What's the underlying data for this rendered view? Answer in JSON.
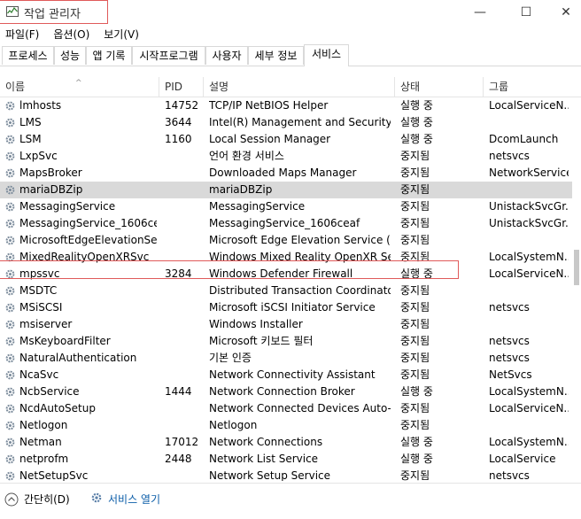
{
  "window": {
    "title": "작업 관리자",
    "minimize": "—",
    "maximize": "☐",
    "close": "✕"
  },
  "menu": [
    {
      "label": "파일(F)"
    },
    {
      "label": "옵션(O)"
    },
    {
      "label": "보기(V)"
    }
  ],
  "tabs": [
    {
      "label": "프로세스",
      "active": false
    },
    {
      "label": "성능",
      "active": false
    },
    {
      "label": "앱 기록",
      "active": false
    },
    {
      "label": "시작프로그램",
      "active": false
    },
    {
      "label": "사용자",
      "active": false
    },
    {
      "label": "세부 정보",
      "active": false
    },
    {
      "label": "서비스",
      "active": true
    }
  ],
  "columns": {
    "name": "이름",
    "pid": "PID",
    "desc": "설명",
    "status": "상태",
    "group": "그룹"
  },
  "rows": [
    {
      "name": "lmhosts",
      "pid": "14752",
      "desc": "TCP/IP NetBIOS Helper",
      "status": "실행 중",
      "group": "LocalServiceN..."
    },
    {
      "name": "LMS",
      "pid": "3644",
      "desc": "Intel(R) Management and Security ...",
      "status": "실행 중",
      "group": ""
    },
    {
      "name": "LSM",
      "pid": "1160",
      "desc": "Local Session Manager",
      "status": "실행 중",
      "group": "DcomLaunch"
    },
    {
      "name": "LxpSvc",
      "pid": "",
      "desc": "언어 환경 서비스",
      "status": "중지됨",
      "group": "netsvcs"
    },
    {
      "name": "MapsBroker",
      "pid": "",
      "desc": "Downloaded Maps Manager",
      "status": "중지됨",
      "group": "NetworkService"
    },
    {
      "name": "mariaDBZip",
      "pid": "",
      "desc": "mariaDBZip",
      "status": "중지됨",
      "group": "",
      "selected": true
    },
    {
      "name": "MessagingService",
      "pid": "",
      "desc": "MessagingService",
      "status": "중지됨",
      "group": "UnistackSvcGr..."
    },
    {
      "name": "MessagingService_1606ceaf",
      "pid": "",
      "desc": "MessagingService_1606ceaf",
      "status": "중지됨",
      "group": "UnistackSvcGr..."
    },
    {
      "name": "MicrosoftEdgeElevationSer...",
      "pid": "",
      "desc": "Microsoft Edge Elevation Service (...",
      "status": "중지됨",
      "group": ""
    },
    {
      "name": "MixedRealityOpenXRSvc",
      "pid": "",
      "desc": "Windows Mixed Reality OpenXR Ser...",
      "status": "중지됨",
      "group": "LocalSystemN..."
    },
    {
      "name": "mpssvc",
      "pid": "3284",
      "desc": "Windows Defender Firewall",
      "status": "실행 중",
      "group": "LocalServiceN..."
    },
    {
      "name": "MSDTC",
      "pid": "",
      "desc": "Distributed Transaction Coordinator",
      "status": "중지됨",
      "group": ""
    },
    {
      "name": "MSiSCSI",
      "pid": "",
      "desc": "Microsoft iSCSI Initiator Service",
      "status": "중지됨",
      "group": "netsvcs"
    },
    {
      "name": "msiserver",
      "pid": "",
      "desc": "Windows Installer",
      "status": "중지됨",
      "group": ""
    },
    {
      "name": "MsKeyboardFilter",
      "pid": "",
      "desc": "Microsoft 키보드 필터",
      "status": "중지됨",
      "group": "netsvcs"
    },
    {
      "name": "NaturalAuthentication",
      "pid": "",
      "desc": "기본 인증",
      "status": "중지됨",
      "group": "netsvcs"
    },
    {
      "name": "NcaSvc",
      "pid": "",
      "desc": "Network Connectivity Assistant",
      "status": "중지됨",
      "group": "NetSvcs"
    },
    {
      "name": "NcbService",
      "pid": "1444",
      "desc": "Network Connection Broker",
      "status": "실행 중",
      "group": "LocalSystemN..."
    },
    {
      "name": "NcdAutoSetup",
      "pid": "",
      "desc": "Network Connected Devices Auto-...",
      "status": "중지됨",
      "group": "LocalServiceN..."
    },
    {
      "name": "Netlogon",
      "pid": "",
      "desc": "Netlogon",
      "status": "중지됨",
      "group": ""
    },
    {
      "name": "Netman",
      "pid": "17012",
      "desc": "Network Connections",
      "status": "실행 중",
      "group": "LocalSystemN..."
    },
    {
      "name": "netprofm",
      "pid": "2448",
      "desc": "Network List Service",
      "status": "실행 중",
      "group": "LocalService"
    },
    {
      "name": "NetSetupSvc",
      "pid": "",
      "desc": "Network Setup Service",
      "status": "중지됨",
      "group": "netsvcs"
    }
  ],
  "footer": {
    "collapse_label": "간단히(D)",
    "open_services_label": "서비스 열기"
  }
}
